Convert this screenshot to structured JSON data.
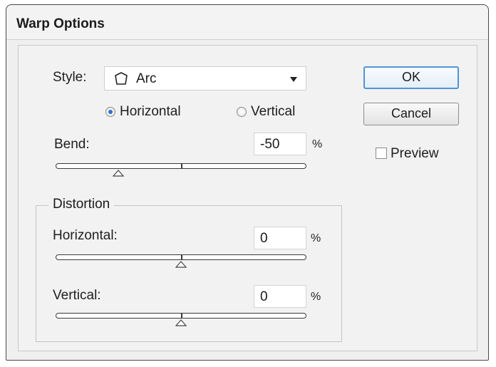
{
  "window": {
    "title": "Warp Options"
  },
  "style": {
    "label": "Style:",
    "value": "Arc",
    "icon": "arc-warp-icon"
  },
  "orientation": {
    "options": [
      "Horizontal",
      "Vertical"
    ],
    "selected": "Horizontal"
  },
  "bend": {
    "label": "Bend:",
    "value": "-50",
    "unit": "%",
    "slider_percent": -50
  },
  "distortion": {
    "legend": "Distortion",
    "horizontal": {
      "label": "Horizontal:",
      "value": "0",
      "unit": "%",
      "slider_percent": 0
    },
    "vertical": {
      "label": "Vertical:",
      "value": "0",
      "unit": "%",
      "slider_percent": 0
    }
  },
  "buttons": {
    "ok": "OK",
    "cancel": "Cancel"
  },
  "preview": {
    "label": "Preview",
    "checked": false
  },
  "colors": {
    "accent": "#2f6fd0",
    "ok_border": "#4f95d6"
  }
}
